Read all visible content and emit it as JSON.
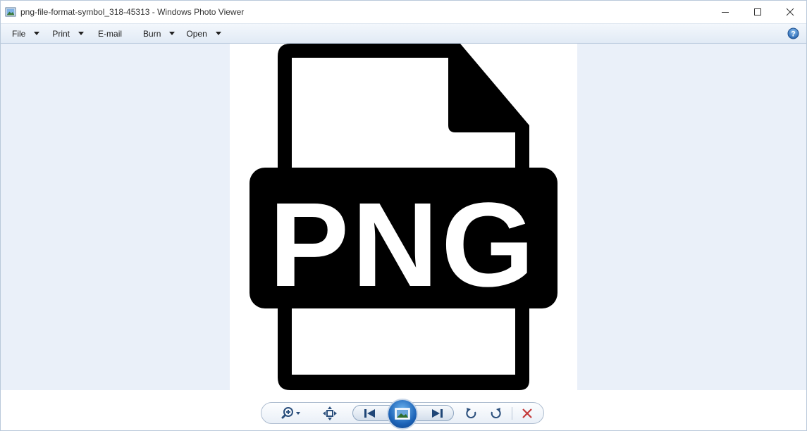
{
  "window": {
    "title": "png-file-format-symbol_318-45313 - Windows Photo Viewer"
  },
  "menu": {
    "items": [
      {
        "label": "File",
        "has_dropdown": true
      },
      {
        "label": "Print",
        "has_dropdown": true
      },
      {
        "label": "E-mail",
        "has_dropdown": false
      },
      {
        "label": "Burn",
        "has_dropdown": true
      },
      {
        "label": "Open",
        "has_dropdown": true
      }
    ],
    "help_icon": "help-icon"
  },
  "image": {
    "label": "PNG",
    "icon": "png-file-icon"
  },
  "controls": {
    "zoom_icon": "zoom-icon",
    "fit_icon": "actual-size-icon",
    "prev_icon": "previous-icon",
    "slideshow_icon": "slideshow-icon",
    "next_icon": "next-icon",
    "rotate_ccw_icon": "rotate-counterclockwise-icon",
    "rotate_cw_icon": "rotate-clockwise-icon",
    "delete_icon": "delete-icon"
  },
  "colors": {
    "menubar": "#e1eaf5",
    "viewer_background": "#eaf0f9",
    "accent": "#1d64b8",
    "delete": "#c43a3a"
  }
}
